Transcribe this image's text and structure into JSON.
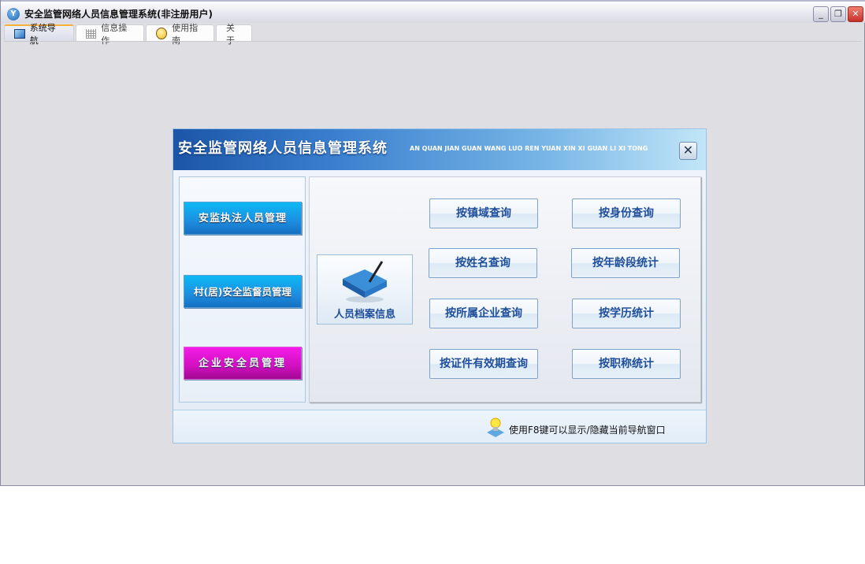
{
  "window": {
    "title": "安全监管网络人员信息管理系统(非注册用户)",
    "app_icon": "yf-logo-icon",
    "controls": [
      "minimize",
      "restore",
      "close"
    ]
  },
  "tabs": [
    {
      "label": "系统导航",
      "icon": "monitor-icon",
      "active": true
    },
    {
      "label": "信息操作",
      "icon": "grid-icon",
      "active": false
    },
    {
      "label": "使用指南",
      "icon": "help-icon",
      "active": false
    },
    {
      "label": "关于",
      "active": false
    }
  ],
  "dialog": {
    "title": "安全监管网络人员信息管理系统",
    "subtitle": "AN QUAN JIAN GUAN WANG LUO REN YUAN XIN XI GUAN LI XI TONG",
    "close_label": "✕",
    "left_buttons": [
      "安监执法人员管理",
      "村(居)安全监督员管理",
      "企业安全员管理"
    ],
    "archive_button": "人员档案信息",
    "query_buttons": [
      "按镇域查询",
      "按身份查询",
      "按姓名查询",
      "按年龄段统计",
      "按所属企业查询",
      "按学历统计",
      "按证件有效期查询",
      "按职称统计"
    ],
    "footer_hint": "使用F8键可以显示/隐藏当前导航窗口"
  }
}
